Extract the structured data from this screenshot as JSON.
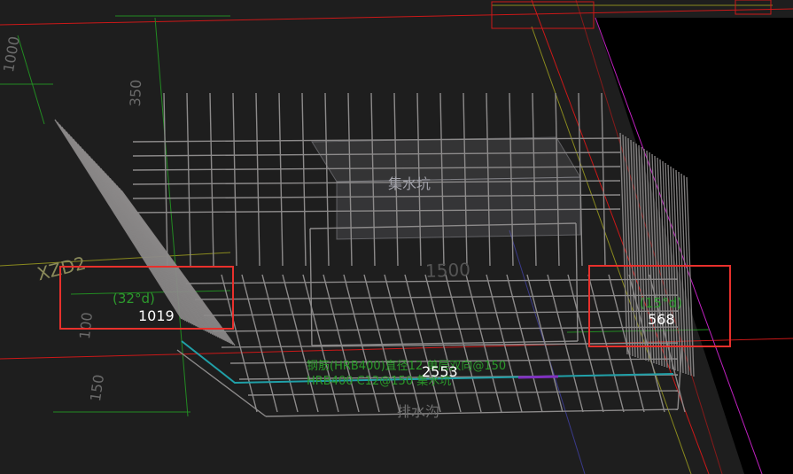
{
  "scene": {
    "background": "#1e1e1e",
    "colors": {
      "rebar": "#8c8a8a",
      "axis_red": "#cc1818",
      "axis_magenta": "#c020c0",
      "axis_green": "#228b22",
      "axis_yellow": "#8a8a1e",
      "highlight": "#e8302c",
      "cyan_edge": "#20a0a8"
    }
  },
  "labels": {
    "left_angle": "(32°d)",
    "left_length": "1019",
    "right_angle": "(15°d)",
    "right_length": "568",
    "bottom_length": "2553",
    "pit_top": "集水坑",
    "pit_bottom": "排水沟",
    "dim_top_left": "1000",
    "dim_vertical_left": "350",
    "dim_inner": "1500",
    "dim_left_low": "100",
    "dim_left_lower": "150",
    "axis_label": "XZD2",
    "green_note_1": "钢筋(HRB400)直径12 单层双向@150",
    "green_note_2": "HRB400 C12@150 集水坑"
  },
  "highlights": [
    {
      "name": "left-highlight-box",
      "target": "left_length"
    },
    {
      "name": "right-highlight-box",
      "target": "right_length"
    }
  ]
}
